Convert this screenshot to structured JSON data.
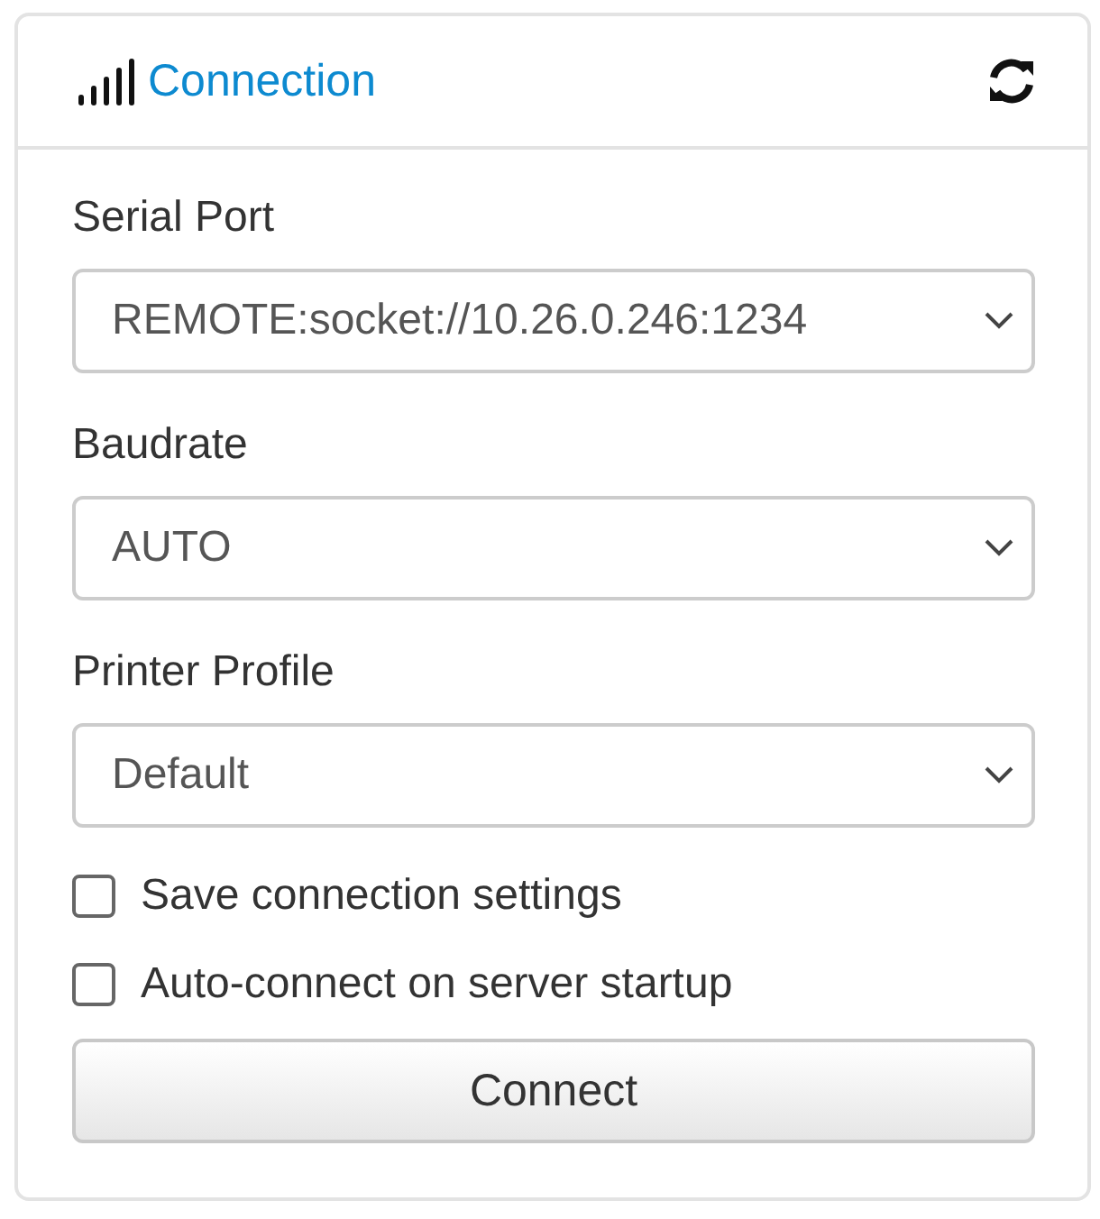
{
  "panel": {
    "title": "Connection"
  },
  "fields": [
    {
      "label": "Serial Port",
      "value": "REMOTE:socket://10.26.0.246:1234"
    },
    {
      "label": "Baudrate",
      "value": "AUTO"
    },
    {
      "label": "Printer Profile",
      "value": "Default"
    }
  ],
  "options": [
    {
      "label": "Save connection settings",
      "checked": false
    },
    {
      "label": "Auto-connect on server startup",
      "checked": false
    }
  ],
  "button": "Connect"
}
